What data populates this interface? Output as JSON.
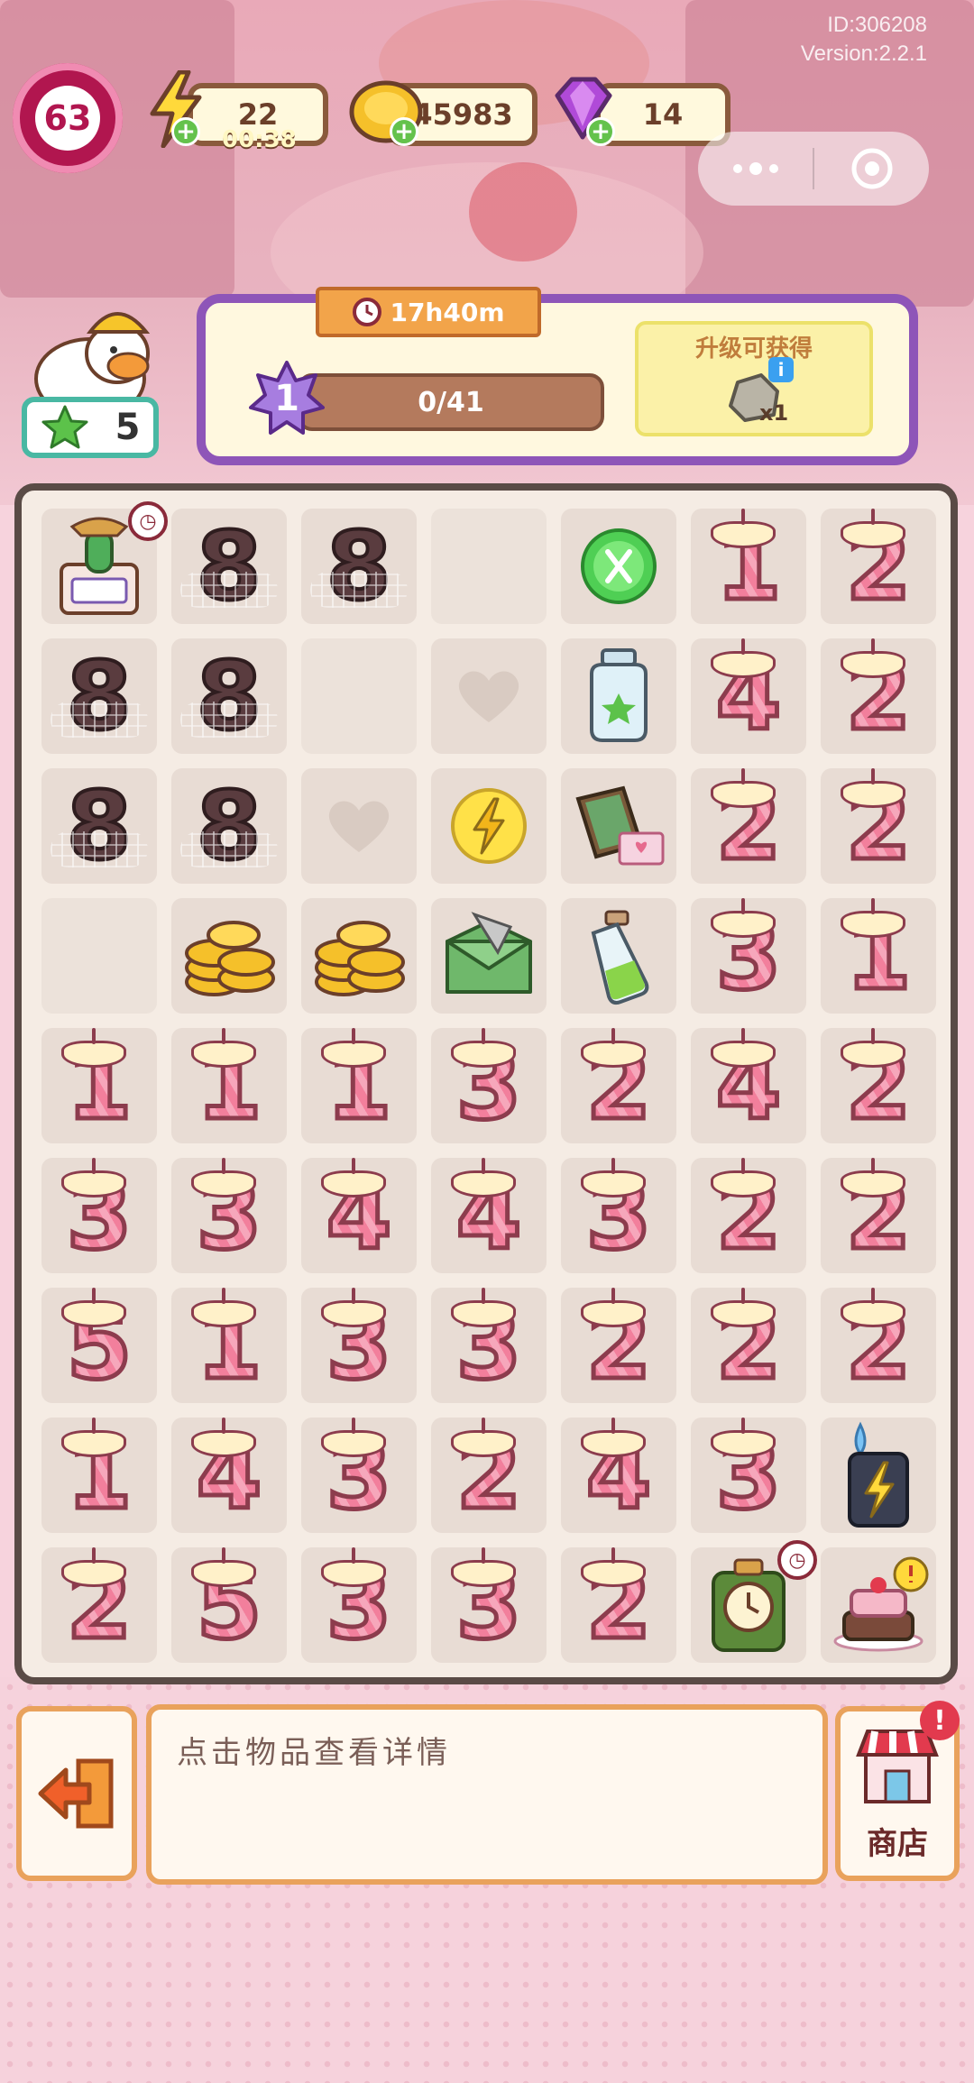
{
  "meta": {
    "id_text": "ID:306208",
    "version_text": "Version:2.2.1"
  },
  "hud": {
    "level": "63",
    "energy": {
      "value": "22",
      "timer": "00:38"
    },
    "coins": {
      "value": "45983"
    },
    "gems": {
      "value": "14"
    },
    "stars": {
      "value": "5"
    }
  },
  "quest": {
    "timer": "17h40m",
    "level": "1",
    "progress_text": "0/41",
    "progress_fraction": 0,
    "reward_title": "升级可获得",
    "reward_qty": "x1"
  },
  "board": {
    "rows": [
      [
        {
          "t": "cactus",
          "timer": true
        },
        {
          "t": "dark",
          "n": "8"
        },
        {
          "t": "dark",
          "n": "8"
        },
        {
          "t": "empty"
        },
        {
          "t": "scissors"
        },
        {
          "t": "candle",
          "n": "1"
        },
        {
          "t": "candle",
          "n": "2"
        }
      ],
      [
        {
          "t": "dark",
          "n": "8"
        },
        {
          "t": "dark",
          "n": "8"
        },
        {
          "t": "empty"
        },
        {
          "t": "heart"
        },
        {
          "t": "jar"
        },
        {
          "t": "candle",
          "n": "4"
        },
        {
          "t": "candle",
          "n": "2"
        }
      ],
      [
        {
          "t": "dark",
          "n": "8"
        },
        {
          "t": "dark",
          "n": "8"
        },
        {
          "t": "heart"
        },
        {
          "t": "energy"
        },
        {
          "t": "book"
        },
        {
          "t": "candle",
          "n": "2"
        },
        {
          "t": "candle",
          "n": "2"
        }
      ],
      [
        {
          "t": "empty"
        },
        {
          "t": "coins"
        },
        {
          "t": "coins"
        },
        {
          "t": "envelope"
        },
        {
          "t": "bottle"
        },
        {
          "t": "candle",
          "n": "3"
        },
        {
          "t": "candle",
          "n": "1"
        }
      ],
      [
        {
          "t": "candle",
          "n": "1"
        },
        {
          "t": "candle",
          "n": "1"
        },
        {
          "t": "candle",
          "n": "1"
        },
        {
          "t": "candle",
          "n": "3"
        },
        {
          "t": "candle",
          "n": "2"
        },
        {
          "t": "candle",
          "n": "4"
        },
        {
          "t": "candle",
          "n": "2"
        }
      ],
      [
        {
          "t": "candle",
          "n": "3"
        },
        {
          "t": "candle",
          "n": "3"
        },
        {
          "t": "candle",
          "n": "4"
        },
        {
          "t": "candle",
          "n": "4"
        },
        {
          "t": "candle",
          "n": "3"
        },
        {
          "t": "candle",
          "n": "2"
        },
        {
          "t": "candle",
          "n": "2"
        }
      ],
      [
        {
          "t": "candle",
          "n": "5"
        },
        {
          "t": "candle",
          "n": "1"
        },
        {
          "t": "candle",
          "n": "3"
        },
        {
          "t": "candle",
          "n": "3"
        },
        {
          "t": "candle",
          "n": "2"
        },
        {
          "t": "candle",
          "n": "2"
        },
        {
          "t": "candle",
          "n": "2"
        }
      ],
      [
        {
          "t": "candle",
          "n": "1"
        },
        {
          "t": "candle",
          "n": "4"
        },
        {
          "t": "candle",
          "n": "3"
        },
        {
          "t": "candle",
          "n": "2"
        },
        {
          "t": "candle",
          "n": "4"
        },
        {
          "t": "candle",
          "n": "3"
        },
        {
          "t": "lighter"
        }
      ],
      [
        {
          "t": "candle",
          "n": "2"
        },
        {
          "t": "candle",
          "n": "5"
        },
        {
          "t": "candle",
          "n": "3"
        },
        {
          "t": "candle",
          "n": "3"
        },
        {
          "t": "candle",
          "n": "2"
        },
        {
          "t": "clock",
          "timer": true
        },
        {
          "t": "cake"
        }
      ]
    ]
  },
  "bottom": {
    "info_text": "点击物品查看详情",
    "shop_label": "商店",
    "alert": "!"
  },
  "colors": {
    "accent": "#8e55b8",
    "candle": "#f07c9a",
    "board_border": "#5a4b46"
  }
}
